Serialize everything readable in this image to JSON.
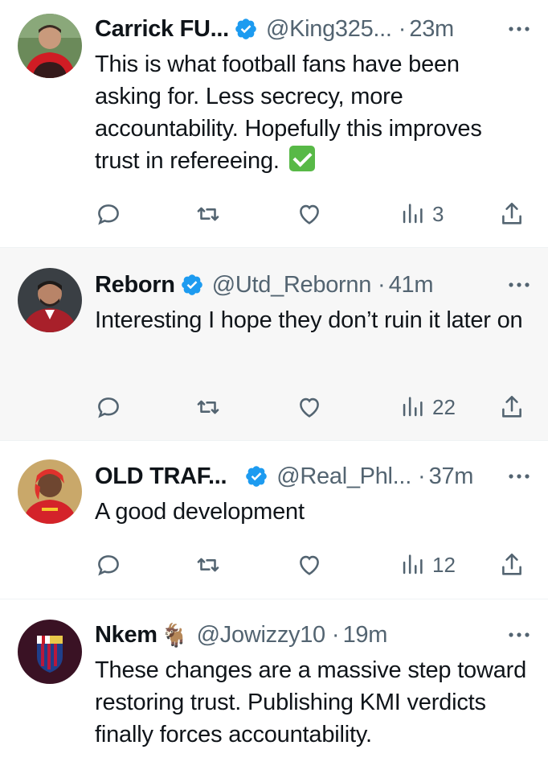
{
  "tweets": [
    {
      "name": "Carrick FU...",
      "handle": "@King325...",
      "time": "23m",
      "verified": true,
      "text": "This is what football fans have been asking for. Less secrecy, more accountability. Hopefully this improves trust in refereeing.",
      "views": "3"
    },
    {
      "name": "Reborn",
      "handle": "@Utd_Rebornn",
      "time": "41m",
      "verified": true,
      "text": "Interesting I hope they don’t  ruin it later on",
      "views": "22"
    },
    {
      "name": "OLD TRAF...",
      "handle": "@Real_Phl...",
      "time": "37m",
      "verified": true,
      "text": "A good development",
      "views": "12"
    },
    {
      "name": "Nkem",
      "name_emoji": "🐐",
      "handle": "@Jowizzy10",
      "time": "19m",
      "verified": false,
      "text": "These changes are a massive step toward restoring trust. Publishing KMI verdicts finally forces accountability."
    }
  ],
  "separator": "·",
  "colors": {
    "verified_badge": "#1d9bf0",
    "secondary_text": "#536471",
    "check_emoji": "#58b947"
  },
  "icons": [
    "reply-icon",
    "retweet-icon",
    "like-icon",
    "views-icon",
    "share-icon",
    "more-icon",
    "verified-badge-icon"
  ]
}
